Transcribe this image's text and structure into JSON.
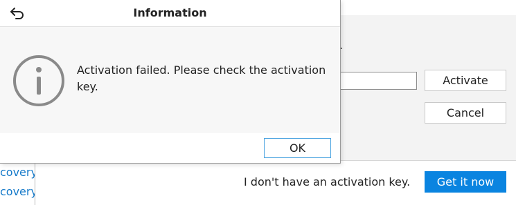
{
  "background_window": {
    "period": ".",
    "activate_label": "Activate",
    "cancel_label": "Cancel",
    "links": [
      "covery",
      "covery"
    ],
    "no_key_text": "I don't have an activation key.",
    "get_it_now_label": "Get it now"
  },
  "dialog": {
    "title": "Information",
    "message": "Activation failed. Please check the activation key.",
    "ok_label": "OK",
    "icons": {
      "back": "back-arrow-icon",
      "info": "info-circle-icon"
    }
  },
  "colors": {
    "accent_blue": "#0a84e0",
    "link_blue": "#1479c9",
    "ok_focus_border": "#4aa3e0"
  }
}
